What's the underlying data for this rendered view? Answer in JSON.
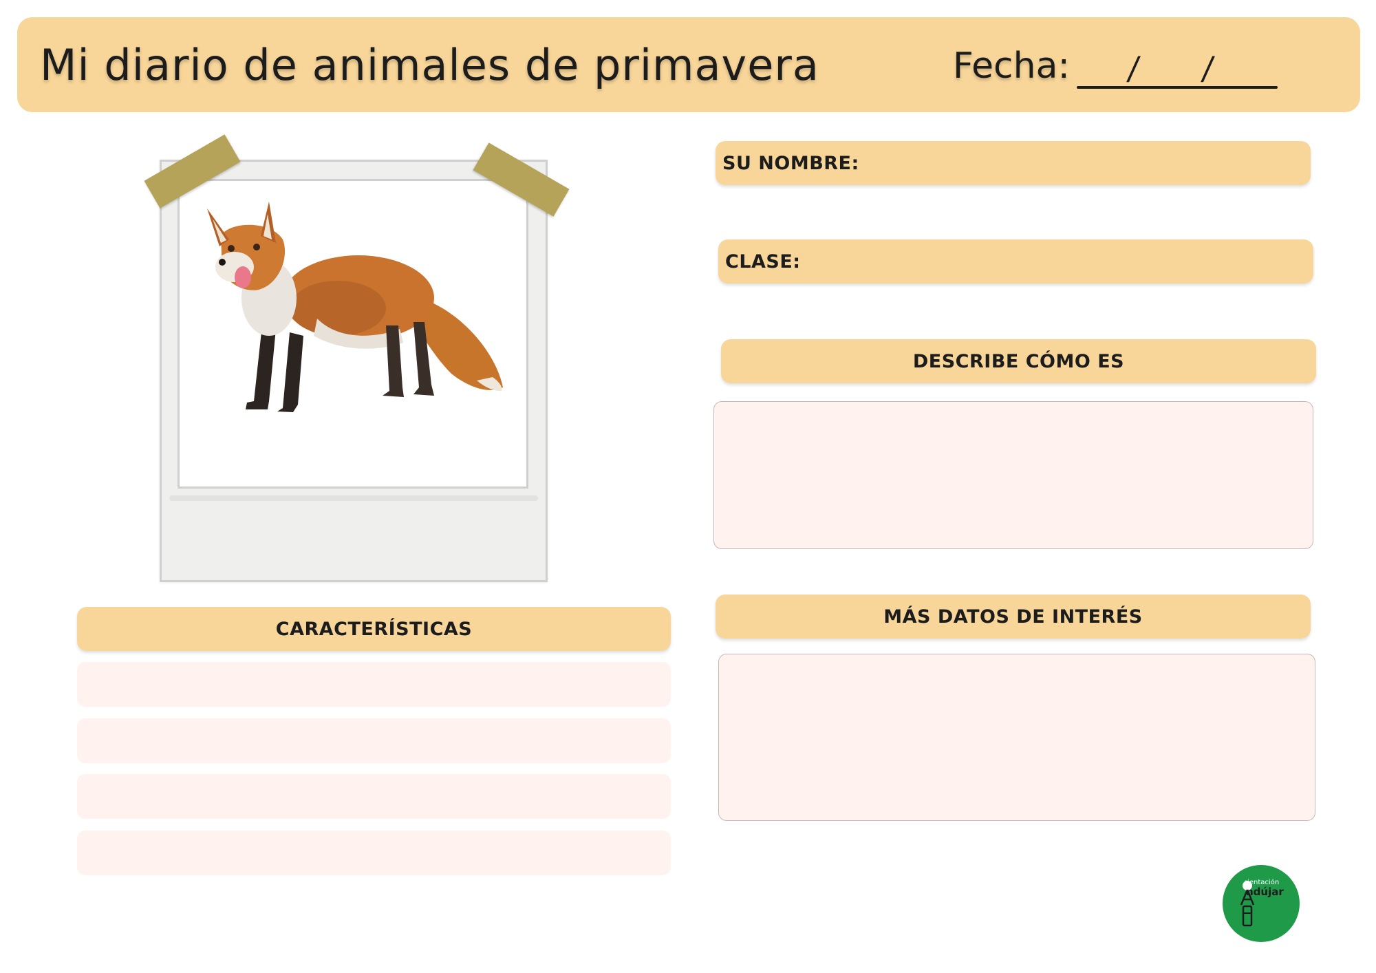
{
  "header": {
    "title": "Mi diario de animales de primavera",
    "date_label": "Fecha:",
    "date_separators": [
      "/",
      "/"
    ]
  },
  "photo": {
    "subject_icon": "fox-illustration",
    "caption": ""
  },
  "fields": {
    "name_label": "SU NOMBRE:",
    "class_label": "CLASE:"
  },
  "sections": {
    "describe": "DESCRIBE CÓMO ES",
    "characteristics": "CARACTERÍSTICAS",
    "more_data": "MÁS DATOS DE INTERÉS"
  },
  "logo": {
    "line1": "rientación",
    "line2": "ndújar"
  },
  "colors": {
    "accent": "#f8d699",
    "box_fill": "#fff2ef",
    "logo_green": "#1e9a49",
    "tape": "#b5a35a"
  }
}
